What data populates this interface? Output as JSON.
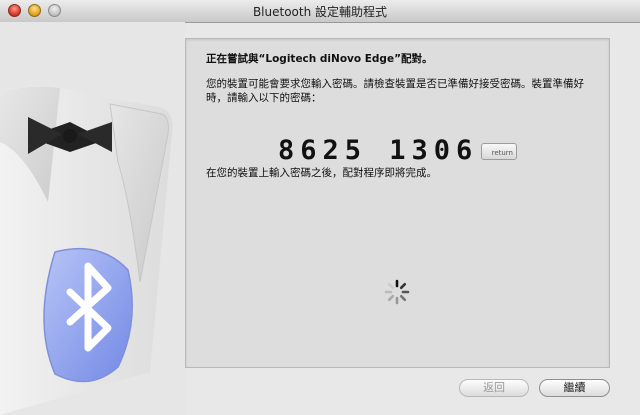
{
  "window": {
    "title": "Bluetooth 設定輔助程式"
  },
  "panel": {
    "heading": "正在嘗試與“Logitech diNovo Edge”配對。",
    "instructions": "您的裝置可能會要求您輸入密碼。請檢查裝置是否已準備好接受密碼。裝置準備好時，請輸入以下的密碼：",
    "passcode": "8625 1306",
    "return_key_label": "return",
    "after_text": "在您的裝置上輸入密碼之後，配對程序即將完成。"
  },
  "buttons": {
    "back": "返回",
    "continue": "繼續"
  },
  "colors": {
    "bluetooth_blue": "#8fa2ee",
    "window_bg": "#e8e8e8"
  }
}
